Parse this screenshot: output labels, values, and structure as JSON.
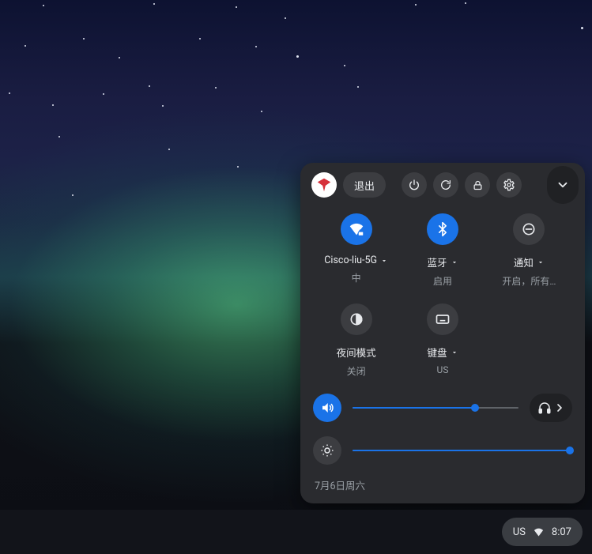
{
  "colors": {
    "accent": "#1a73e8",
    "panel_bg": "#2a2b2f",
    "pill_bg": "#3c3d41",
    "text": "#e8eaed",
    "text_secondary": "#9aa0a6"
  },
  "quick_settings": {
    "top_bar": {
      "sign_out_label": "退出",
      "icons": {
        "avatar": "avatar-dove-red",
        "power": "power-icon",
        "restart": "restart-icon",
        "lock": "lock-icon",
        "settings": "gear-icon",
        "collapse": "chevron-down-icon"
      }
    },
    "tiles": [
      {
        "id": "wifi",
        "title": "Cisco-liu-5G",
        "subtitle": "中",
        "on": true,
        "has_menu": true,
        "icon": "wifi-secure-icon"
      },
      {
        "id": "bluetooth",
        "title": "蓝牙",
        "subtitle": "启用",
        "on": true,
        "has_menu": true,
        "icon": "bluetooth-icon"
      },
      {
        "id": "notifications",
        "title": "通知",
        "subtitle": "开启，所有…",
        "on": false,
        "has_menu": true,
        "icon": "dnd-icon"
      },
      {
        "id": "night-light",
        "title": "夜间模式",
        "subtitle": "关闭",
        "on": false,
        "has_menu": false,
        "icon": "night-light-icon"
      },
      {
        "id": "keyboard",
        "title": "键盘",
        "subtitle": "US",
        "on": false,
        "has_menu": true,
        "icon": "keyboard-icon"
      }
    ],
    "sliders": {
      "volume": {
        "value": 0.74,
        "icon": "volume-icon",
        "muted": false,
        "audio_settings_icon": "headphones-icon"
      },
      "brightness": {
        "value": 0.99,
        "icon": "brightness-icon"
      }
    },
    "date_label": "7月6日周六"
  },
  "shelf": {
    "ime": "US",
    "wifi_icon": "wifi-icon",
    "clock": "8:07"
  }
}
